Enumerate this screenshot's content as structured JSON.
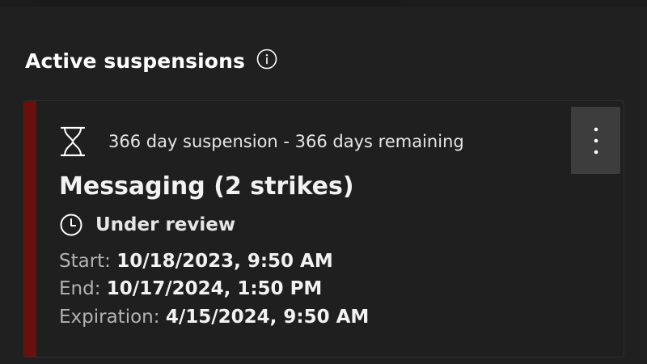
{
  "section": {
    "title": "Active suspensions",
    "info_icon": "info-icon"
  },
  "card": {
    "accent_color": "#6a0f0b",
    "duration_text": "366 day suspension - 366 days remaining",
    "duration_icon": "hourglass-icon",
    "title": "Messaging (2 strikes)",
    "status_icon": "clock-icon",
    "status": "Under review",
    "more_icon": "more-vertical-icon",
    "start_label": "Start: ",
    "start_value": "10/18/2023, 9:50 AM",
    "end_label": "End: ",
    "end_value": "10/17/2024, 1:50 PM",
    "expiration_label": "Expiration: ",
    "expiration_value": "4/15/2024, 9:50 AM"
  }
}
